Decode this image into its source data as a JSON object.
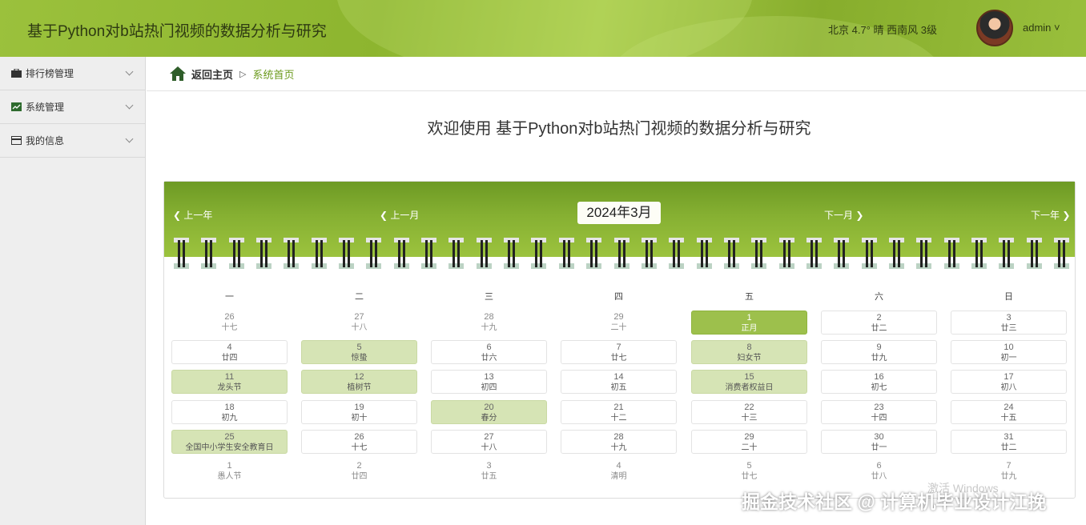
{
  "header": {
    "title": "基于Python对b站热门视频的数据分析与研究",
    "weather": "北京  4.7°  晴  西南风  3级",
    "user": "admin ˅"
  },
  "sidebar": {
    "items": [
      {
        "label": "排行榜管理",
        "icon": "briefcase-icon"
      },
      {
        "label": "系统管理",
        "icon": "chart-icon"
      },
      {
        "label": "我的信息",
        "icon": "card-icon"
      }
    ]
  },
  "breadcrumb": {
    "home": "返回主页",
    "sep": "▷",
    "current": "系统首页"
  },
  "welcome": "欢迎使用 基于Python对b站热门视频的数据分析与研究",
  "calendar": {
    "prev_year": "上一年",
    "prev_month": "上一月",
    "month_title": "2024年3月",
    "next_month": "下一月",
    "next_year": "下一年",
    "weekdays": [
      "一",
      "二",
      "三",
      "四",
      "五",
      "六",
      "日"
    ],
    "weeks": [
      [
        {
          "d": "26",
          "l": "十七",
          "t": "other"
        },
        {
          "d": "27",
          "l": "十八",
          "t": "other"
        },
        {
          "d": "28",
          "l": "十九",
          "t": "other"
        },
        {
          "d": "29",
          "l": "二十",
          "t": "other"
        },
        {
          "d": "1",
          "l": "正月",
          "t": "today"
        },
        {
          "d": "2",
          "l": "廿二",
          "t": "cur"
        },
        {
          "d": "3",
          "l": "廿三",
          "t": "cur"
        }
      ],
      [
        {
          "d": "4",
          "l": "廿四",
          "t": "cur"
        },
        {
          "d": "5",
          "l": "惊蛰",
          "t": "fest"
        },
        {
          "d": "6",
          "l": "廿六",
          "t": "cur"
        },
        {
          "d": "7",
          "l": "廿七",
          "t": "cur"
        },
        {
          "d": "8",
          "l": "妇女节",
          "t": "fest"
        },
        {
          "d": "9",
          "l": "廿九",
          "t": "cur"
        },
        {
          "d": "10",
          "l": "初一",
          "t": "cur"
        }
      ],
      [
        {
          "d": "11",
          "l": "龙头节",
          "t": "fest"
        },
        {
          "d": "12",
          "l": "植树节",
          "t": "fest"
        },
        {
          "d": "13",
          "l": "初四",
          "t": "cur"
        },
        {
          "d": "14",
          "l": "初五",
          "t": "cur"
        },
        {
          "d": "15",
          "l": "消费者权益日",
          "t": "fest"
        },
        {
          "d": "16",
          "l": "初七",
          "t": "cur"
        },
        {
          "d": "17",
          "l": "初八",
          "t": "cur"
        }
      ],
      [
        {
          "d": "18",
          "l": "初九",
          "t": "cur"
        },
        {
          "d": "19",
          "l": "初十",
          "t": "cur"
        },
        {
          "d": "20",
          "l": "春分",
          "t": "fest"
        },
        {
          "d": "21",
          "l": "十二",
          "t": "cur"
        },
        {
          "d": "22",
          "l": "十三",
          "t": "cur"
        },
        {
          "d": "23",
          "l": "十四",
          "t": "cur"
        },
        {
          "d": "24",
          "l": "十五",
          "t": "cur"
        }
      ],
      [
        {
          "d": "25",
          "l": "全国中小学生安全教育日",
          "t": "fest"
        },
        {
          "d": "26",
          "l": "十七",
          "t": "cur"
        },
        {
          "d": "27",
          "l": "十八",
          "t": "cur"
        },
        {
          "d": "28",
          "l": "十九",
          "t": "cur"
        },
        {
          "d": "29",
          "l": "二十",
          "t": "cur"
        },
        {
          "d": "30",
          "l": "廿一",
          "t": "cur"
        },
        {
          "d": "31",
          "l": "廿二",
          "t": "cur"
        }
      ],
      [
        {
          "d": "1",
          "l": "愚人节",
          "t": "other"
        },
        {
          "d": "2",
          "l": "廿四",
          "t": "other"
        },
        {
          "d": "3",
          "l": "廿五",
          "t": "other"
        },
        {
          "d": "4",
          "l": "清明",
          "t": "other"
        },
        {
          "d": "5",
          "l": "廿七",
          "t": "other"
        },
        {
          "d": "6",
          "l": "廿八",
          "t": "other"
        },
        {
          "d": "7",
          "l": "廿九",
          "t": "other"
        }
      ]
    ]
  },
  "watermark": {
    "activate": "激活 Windows",
    "credit": "掘金技术社区 @ 计算机毕业设计江挽"
  },
  "colors": {
    "accent": "#8db52f",
    "festival_bg": "#d6e4b5",
    "today_bg": "#9dc04c"
  }
}
